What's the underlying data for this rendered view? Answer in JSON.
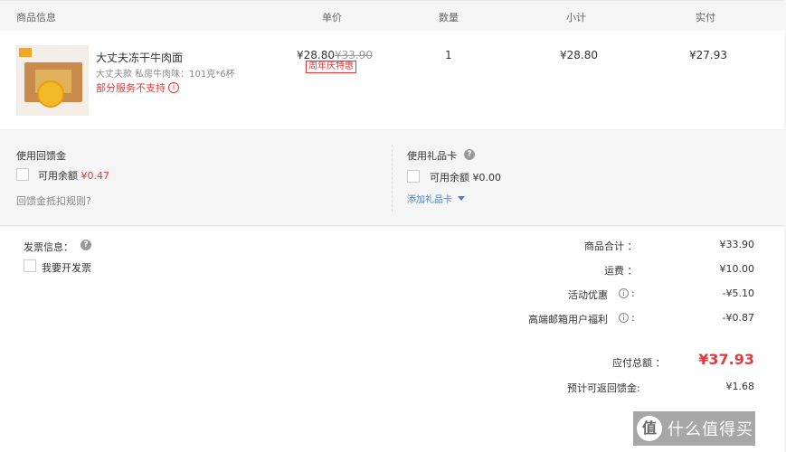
{
  "header": {
    "col_product": "商品信息",
    "col_unit_price": "单价",
    "col_quantity": "数量",
    "col_subtotal": "小计",
    "col_actual": "实付"
  },
  "product": {
    "name": "大丈夫冻干牛肉面",
    "spec": "大丈夫款 私房牛肉味：101克*6杯",
    "warning": "部分服务不支持",
    "price": "¥28.80",
    "original_price": "¥33.90",
    "promo_tag": "周年庆特惠",
    "quantity": "1",
    "subtotal": "¥28.80",
    "actual": "¥27.93",
    "thumb_label": "大丈夫牛肉面"
  },
  "rebate": {
    "title": "使用回馈金",
    "available_label": "可用余额",
    "available_value": "¥0.47",
    "rule_link": "回馈金抵扣规则?"
  },
  "giftcard": {
    "title": "使用礼品卡",
    "available_label": "可用余额",
    "available_value": "¥0.00",
    "add_link": "添加礼品卡"
  },
  "invoice": {
    "title": "发票信息：",
    "checkbox_label": "我要开发票"
  },
  "summary": {
    "goods_total_label": "商品合计 ：",
    "goods_total_value": "¥33.90",
    "shipping_label": "运费 ：",
    "shipping_value": "¥10.00",
    "promo_label": "活动优惠",
    "promo_value": "-¥5.10",
    "member_label": "高端邮箱用户福利",
    "member_value": "-¥0.87",
    "payable_label": "应付总额 ：",
    "payable_value": "¥37.93",
    "rebate_return_label": "预计可返回馈金:",
    "rebate_return_value": "¥1.68"
  },
  "watermark": {
    "logo_char": "值",
    "text": "什么值得买"
  },
  "colors": {
    "accent_red": "#e4393c",
    "link_blue": "#4a7fc1"
  }
}
